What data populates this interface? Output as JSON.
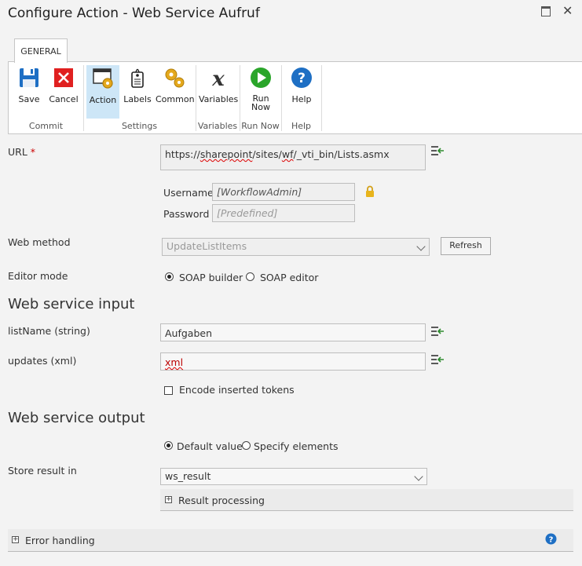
{
  "window": {
    "title": "Configure Action - Web Service Aufruf"
  },
  "ribbon": {
    "tab": "GENERAL",
    "buttons": {
      "save": "Save",
      "cancel": "Cancel",
      "action": "Action",
      "labels": "Labels",
      "common": "Common",
      "variables": "Variables",
      "run_now_line1": "Run",
      "run_now_line2": "Now",
      "help": "Help"
    },
    "groups": {
      "commit": "Commit",
      "settings": "Settings",
      "variables": "Variables",
      "run_now": "Run Now",
      "help": "Help"
    }
  },
  "form": {
    "url": {
      "label": "URL",
      "required_mark": "*",
      "prefix": "https://",
      "w1": "sharepoint",
      "mid": "/sites/",
      "w2": "wf",
      "suffix": "/_vti_bin/Lists.asmx"
    },
    "username": {
      "label": "Username",
      "value": "[WorkflowAdmin]"
    },
    "password": {
      "label": "Password",
      "value": "[Predefined]"
    },
    "web_method": {
      "label": "Web method",
      "value": "UpdateListItems",
      "refresh_label": "Refresh"
    },
    "editor_mode": {
      "label": "Editor mode",
      "option_soap_builder": "SOAP builder",
      "option_soap_editor": "SOAP editor",
      "selected": "SOAP builder"
    }
  },
  "input_section": {
    "title": "Web service input",
    "list_name": {
      "label": "listName (string)",
      "value": "Aufgaben"
    },
    "updates": {
      "label": "updates (xml)",
      "value": "xml"
    },
    "encode_tokens": {
      "label": "Encode inserted tokens",
      "checked": false
    }
  },
  "output_section": {
    "title": "Web service output",
    "option_default": "Default value",
    "option_specify": "Specify elements",
    "selected": "Default value",
    "store_result": {
      "label": "Store result in",
      "value": "ws_result"
    },
    "result_processing": "Result processing"
  },
  "error_handling": {
    "label": "Error handling"
  },
  "colors": {
    "accent_blue": "#1e6fc4",
    "required_red": "#cc0000",
    "insert_green": "#2e8b2e"
  }
}
